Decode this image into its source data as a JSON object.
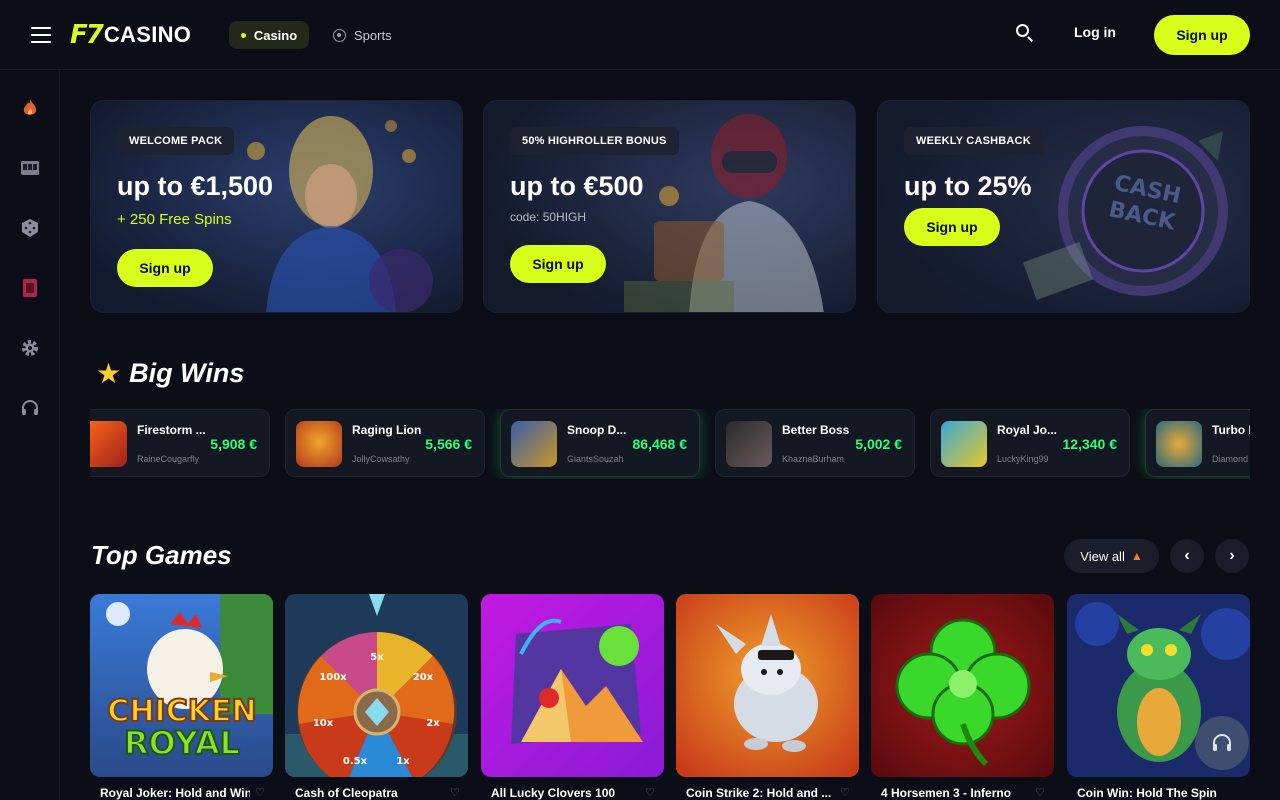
{
  "header": {
    "logo_mark": "F7",
    "logo_text": "CASINO",
    "nav": {
      "casino": "Casino",
      "sports": "Sports"
    },
    "login": "Log in",
    "signup": "Sign up"
  },
  "sidebar": {
    "items": [
      {
        "icon": "flame-icon"
      },
      {
        "icon": "slot-machine-icon"
      },
      {
        "icon": "dice-icon"
      },
      {
        "icon": "cards-icon"
      },
      {
        "icon": "gear-icon"
      },
      {
        "icon": "headset-icon"
      }
    ]
  },
  "promos": [
    {
      "tag": "WELCOME PACK",
      "headline": "up to €1,500",
      "sub": "+ 250 Free Spins",
      "button": "Sign up"
    },
    {
      "tag": "50% HIGHROLLER BONUS",
      "headline": "up to €500",
      "sub": "code: 50HIGH",
      "button": "Sign up"
    },
    {
      "tag": "WEEKLY CASHBACK",
      "headline": "up to 25%",
      "button": "Sign up"
    }
  ],
  "big_wins": {
    "title": "Big Wins",
    "items": [
      {
        "game": "Firestorm ...",
        "user": "RaineCougarfly",
        "amount": "5,908 €"
      },
      {
        "game": "Raging Lion",
        "user": "JollyCowsathy",
        "amount": "5,566 €"
      },
      {
        "game": "Snoop D...",
        "user": "GiantsSouzah",
        "amount": "86,468 €"
      },
      {
        "game": "Better Boss",
        "user": "KhaznaBurham",
        "amount": "5,002 €"
      },
      {
        "game": "Royal Jo...",
        "user": "LuckyKing99",
        "amount": "12,340 €"
      },
      {
        "game": "Turbo D",
        "user": "Diamond",
        "amount": ""
      }
    ]
  },
  "top_games": {
    "title": "Top Games",
    "view_all": "View all",
    "prev": "‹",
    "next": "›",
    "games": [
      {
        "name": "Royal Joker: Hold and Win",
        "art_text_1": "CHICKEN",
        "art_text_2": "ROYAL"
      },
      {
        "name": "Cash of Cleopatra",
        "wheel": [
          "5x",
          "20x",
          "2x",
          "1x",
          "0.5x",
          "10x",
          "100x"
        ]
      },
      {
        "name": "All Lucky Clovers 100"
      },
      {
        "name": "Coin Strike 2: Hold and ..."
      },
      {
        "name": "4 Horsemen 3 - Inferno"
      },
      {
        "name": "Coin Win: Hold The Spin"
      }
    ]
  },
  "colors": {
    "accent": "#d7ff1a",
    "win_green": "#2dff7a",
    "bg": "#0c0e17"
  }
}
